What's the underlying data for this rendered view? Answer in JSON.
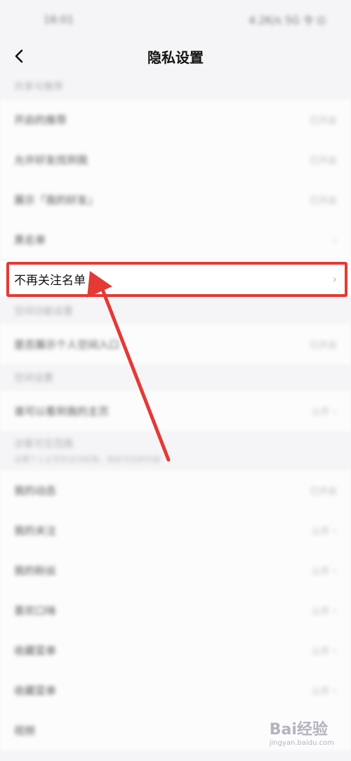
{
  "status_bar": {
    "time": "16:01",
    "indicators": "4.2K/s 5G 令 ⊡"
  },
  "nav": {
    "title": "隐私设置",
    "back_icon": "chevron-left-icon"
  },
  "sections": [
    {
      "header": "共享与推荐",
      "rows": [
        {
          "label": "开启的推荐",
          "value": "已开启"
        },
        {
          "label": "允许好友找到我",
          "value": "已开启"
        },
        {
          "label": "展示「我的好友」",
          "value": "已开启"
        },
        {
          "label": "黑名单",
          "value": ""
        }
      ]
    }
  ],
  "highlight_row": {
    "label": "不再关注名单"
  },
  "sections_after": [
    {
      "header": "空间功能设置",
      "rows": [
        {
          "label": "是否展示个人空间入口",
          "value": "已开启"
        }
      ]
    },
    {
      "header": "空间设置",
      "rows": [
        {
          "label": "谁可以看到我的主页",
          "value": "公开"
        }
      ]
    },
    {
      "header": "访客可见范围",
      "sub": "设置个人主页的访问权限，指定可见的内容",
      "rows": [
        {
          "label": "我的动态",
          "value": "已开启"
        },
        {
          "label": "我的关注",
          "value": "公开"
        },
        {
          "label": "我的粉丝",
          "value": "公开"
        },
        {
          "label": "喜欢口味",
          "value": "公开"
        },
        {
          "label": "收藏菜单",
          "value": "公开"
        },
        {
          "label": "收藏菜单",
          "value": "公开"
        },
        {
          "label": "视频",
          "value": ""
        }
      ]
    }
  ],
  "watermark": {
    "brand": "Bai经验",
    "url": "jingyan.baidu.com"
  },
  "colors": {
    "highlight": "#e53935",
    "background": "#f5f5f7"
  }
}
